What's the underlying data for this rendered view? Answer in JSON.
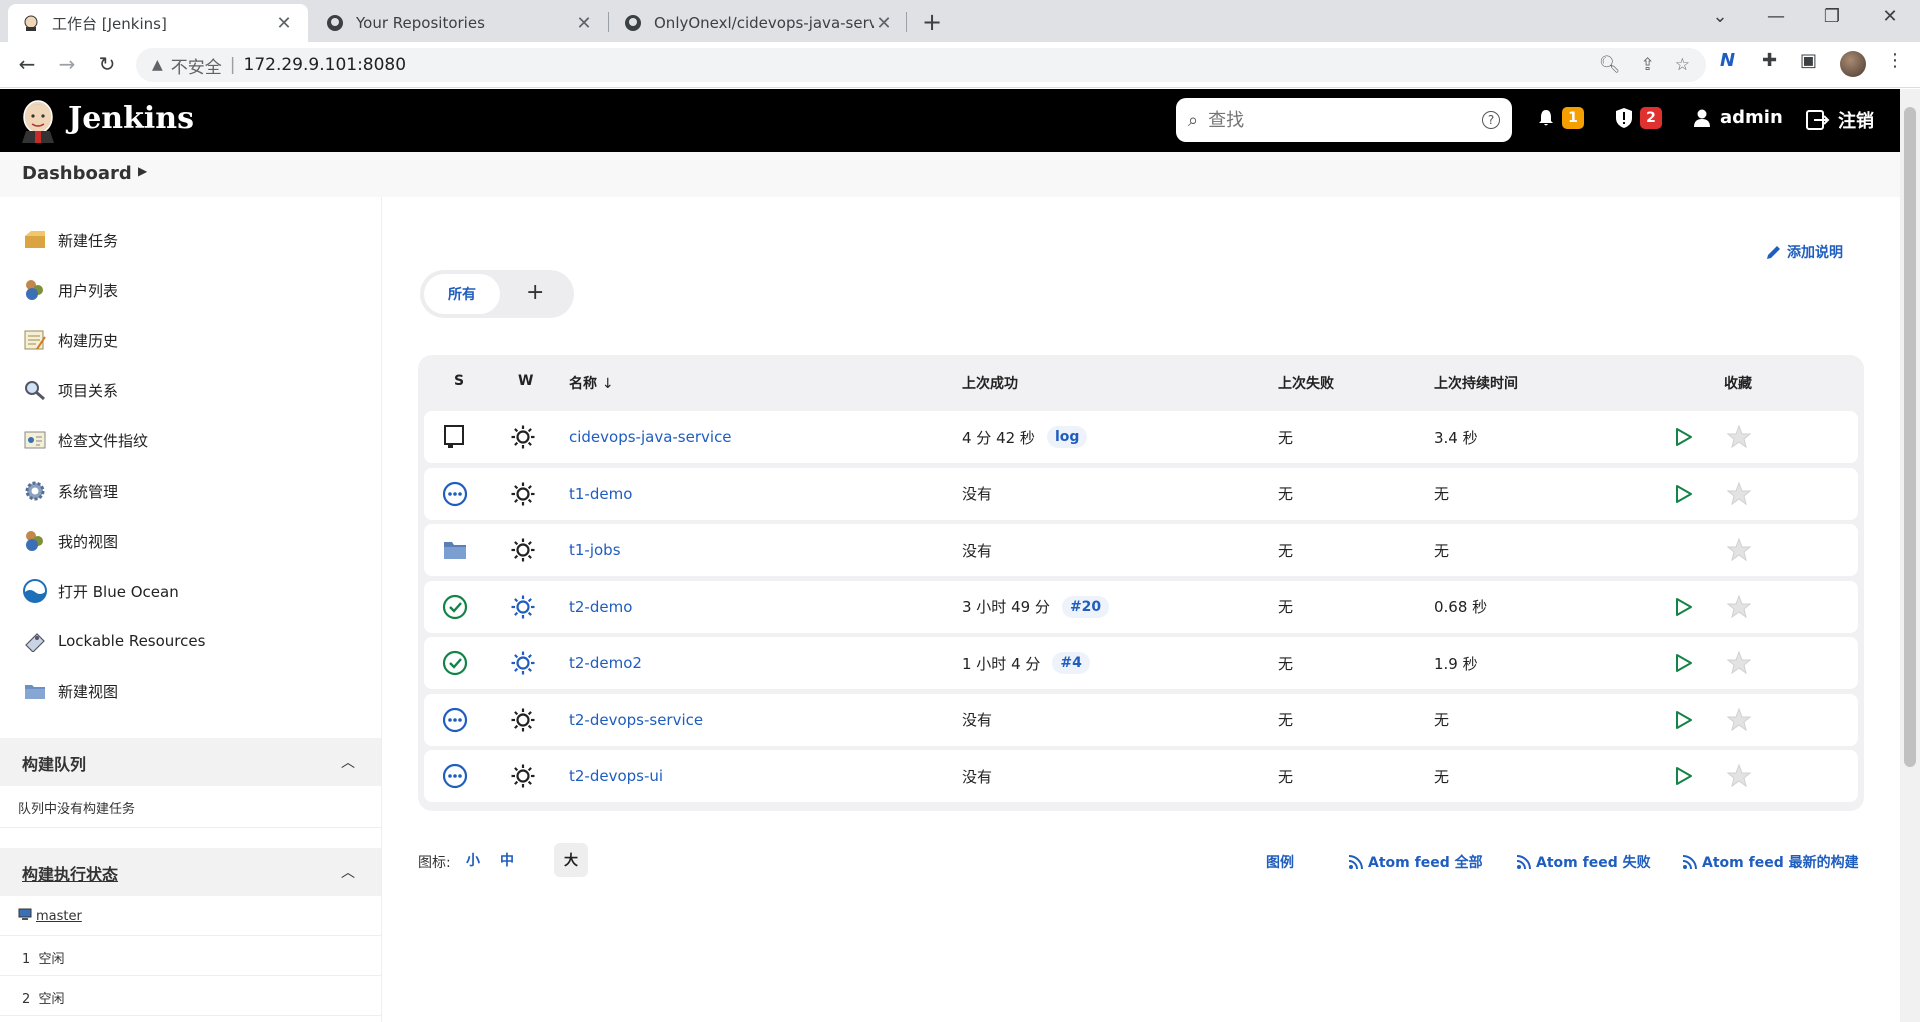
{
  "browser": {
    "tabs": [
      {
        "label": "工作台 [Jenkins]",
        "icon": "jenkins-favicon",
        "active": true
      },
      {
        "label": "Your Repositories",
        "icon": "github-icon",
        "active": false
      },
      {
        "label": "OnlyOnexl/cidevops-java-serv",
        "icon": "github-icon",
        "active": false
      }
    ],
    "address": {
      "security_label": "不安全",
      "url": "172.29.9.101:8080"
    }
  },
  "header": {
    "title": "Jenkins",
    "search_placeholder": "查找",
    "notifications_count": "1",
    "security_count": "2",
    "user": "admin",
    "logout": "注销"
  },
  "breadcrumb": {
    "dashboard": "Dashboard"
  },
  "sidebar": {
    "items": [
      {
        "label": "新建任务",
        "icon": "new-item-icon"
      },
      {
        "label": "用户列表",
        "icon": "people-icon"
      },
      {
        "label": "构建历史",
        "icon": "build-history-icon"
      },
      {
        "label": "项目关系",
        "icon": "search-icon"
      },
      {
        "label": "检查文件指纹",
        "icon": "fingerprint-icon"
      },
      {
        "label": "系统管理",
        "icon": "gear-icon"
      },
      {
        "label": "我的视图",
        "icon": "people-icon"
      },
      {
        "label": "打开 Blue Ocean",
        "icon": "blue-ocean-icon"
      },
      {
        "label": "Lockable Resources",
        "icon": "lock-icon"
      },
      {
        "label": "新建视图",
        "icon": "folder-icon"
      }
    ],
    "queue": {
      "title": "构建队列",
      "empty": "队列中没有构建任务"
    },
    "executors": {
      "title": "构建执行状态",
      "node": "master",
      "rows": [
        {
          "num": "1",
          "status": "空闲"
        },
        {
          "num": "2",
          "status": "空闲"
        }
      ]
    }
  },
  "main": {
    "add_description": "添加说明",
    "view_tab_all": "所有",
    "columns": {
      "s": "S",
      "w": "W",
      "name": "名称",
      "sort_arrow": "↓",
      "last_success": "上次成功",
      "last_failure": "上次失败",
      "last_duration": "上次持续时间",
      "favorite": "收藏"
    },
    "jobs": [
      {
        "name": "cidevops-java-service",
        "status": "pipeline",
        "last_success": "4 分 42 秒",
        "success_link": "log",
        "last_failure": "无",
        "duration": "3.4 秒",
        "can_build": true
      },
      {
        "name": "t1-demo",
        "status": "notbuilt",
        "last_success": "没有",
        "success_link": "",
        "last_failure": "无",
        "duration": "无",
        "can_build": true
      },
      {
        "name": "t1-jobs",
        "status": "folder",
        "last_success": "没有",
        "success_link": "",
        "last_failure": "无",
        "duration": "无",
        "can_build": false
      },
      {
        "name": "t2-demo",
        "status": "success",
        "last_success": "3 小时 49 分",
        "success_link": "#20",
        "last_failure": "无",
        "duration": "0.68 秒",
        "can_build": true
      },
      {
        "name": "t2-demo2",
        "status": "success",
        "last_success": "1 小时 4 分",
        "success_link": "#4",
        "last_failure": "无",
        "duration": "1.9 秒",
        "can_build": true
      },
      {
        "name": "t2-devops-service",
        "status": "notbuilt",
        "last_success": "没有",
        "success_link": "",
        "last_failure": "无",
        "duration": "无",
        "can_build": true
      },
      {
        "name": "t2-devops-ui",
        "status": "notbuilt",
        "last_success": "没有",
        "success_link": "",
        "last_failure": "无",
        "duration": "无",
        "can_build": true
      }
    ],
    "legend": {
      "icon_label": "图标:",
      "sizes": [
        "小",
        "中",
        "大"
      ],
      "selected_size": "大",
      "legend_link": "图例",
      "feeds": [
        "Atom feed 全部",
        "Atom feed 失败",
        "Atom feed 最新的构建"
      ]
    }
  },
  "colors": {
    "link": "#1f5dbf",
    "success": "#138347",
    "notbuilt": "#1f5dbf",
    "play": "#138347"
  }
}
